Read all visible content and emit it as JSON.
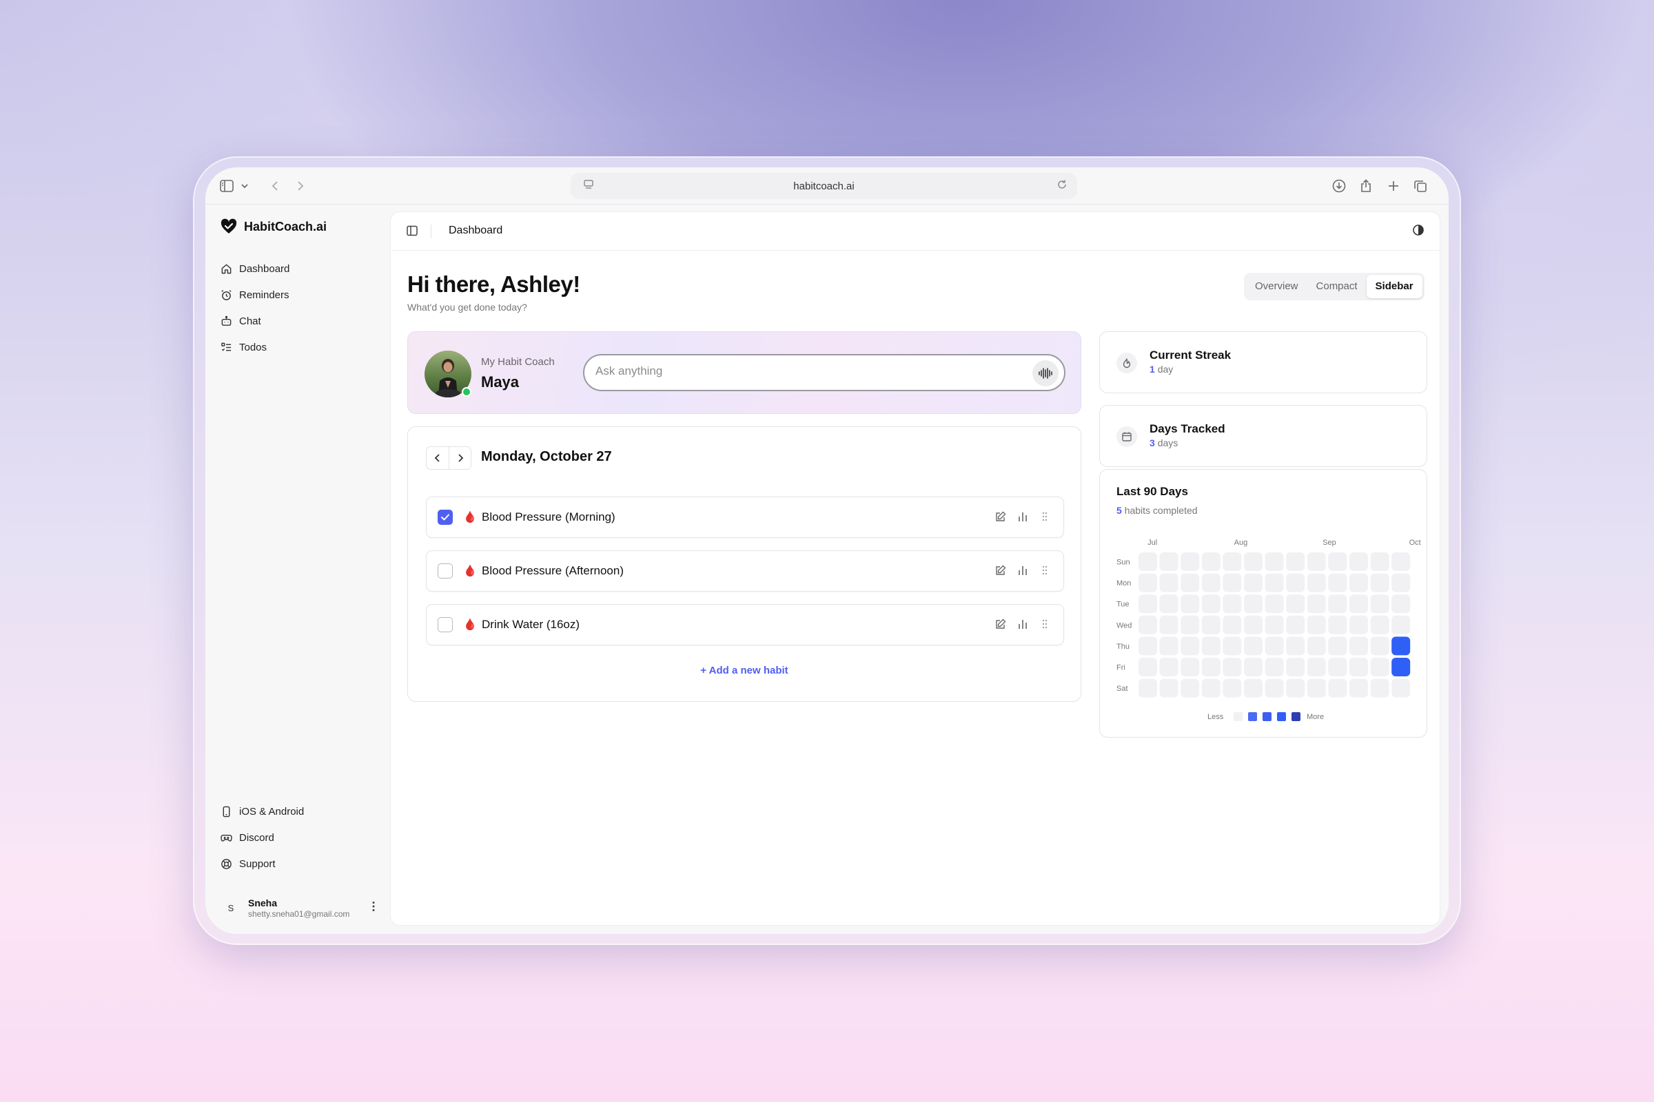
{
  "browser": {
    "url": "habitcoach.ai"
  },
  "app": {
    "brand": "HabitCoach.ai"
  },
  "sidebar": {
    "nav": [
      {
        "label": "Dashboard",
        "icon": "home-icon"
      },
      {
        "label": "Reminders",
        "icon": "alarm-clock-icon"
      },
      {
        "label": "Chat",
        "icon": "bot-icon"
      },
      {
        "label": "Todos",
        "icon": "list-todo-icon"
      }
    ],
    "bottom": [
      {
        "label": "iOS & Android",
        "icon": "smartphone-icon"
      },
      {
        "label": "Discord",
        "icon": "gamepad-icon"
      },
      {
        "label": "Support",
        "icon": "life-buoy-icon"
      }
    ],
    "user": {
      "initial": "S",
      "name": "Sneha",
      "email": "shetty.sneha01@gmail.com"
    }
  },
  "header": {
    "title": "Dashboard"
  },
  "greeting": {
    "title": "Hi there, Ashley!",
    "subtitle": "What'd you get done today?"
  },
  "view_toggle": {
    "options": [
      "Overview",
      "Compact",
      "Sidebar"
    ],
    "selected": "Sidebar"
  },
  "coach": {
    "label": "My Habit Coach",
    "name": "Maya",
    "status": "online",
    "ask_placeholder": "Ask anything",
    "ask_value": ""
  },
  "habits": {
    "date": "Monday, October 27",
    "items": [
      {
        "name": "Blood Pressure (Morning)",
        "emoji": "🩸",
        "checked": true
      },
      {
        "name": "Blood Pressure (Afternoon)",
        "emoji": "🩸",
        "checked": false
      },
      {
        "name": "Drink Water (16oz)",
        "emoji": "🩸",
        "checked": false
      }
    ],
    "add_label": "+ Add a new habit"
  },
  "stats": {
    "streak": {
      "title": "Current Streak",
      "value": "1",
      "unit": "day"
    },
    "tracked": {
      "title": "Days Tracked",
      "value": "3",
      "unit": "days"
    }
  },
  "heatmap": {
    "title": "Last 90 Days",
    "completed_count": "5",
    "completed_label": "habits completed",
    "months": [
      "Jul",
      "Aug",
      "Sep",
      "Oct"
    ],
    "days": [
      "Sun",
      "Mon",
      "Tue",
      "Wed",
      "Thu",
      "Fri",
      "Sat"
    ],
    "weeks": 13,
    "active_cells": [
      {
        "week": 12,
        "day": 4,
        "level": 3
      },
      {
        "week": 12,
        "day": 5,
        "level": 3
      }
    ],
    "legend_less": "Less",
    "legend_more": "More",
    "colors": {
      "empty": "#f1f1f3",
      "level1": "#4b6bf5",
      "level2": "#3d5ef0",
      "level3": "#2f5ff7",
      "level4": "#2f3fb0"
    }
  },
  "colors": {
    "accent": "#4f5ff0",
    "online": "#22c55e"
  }
}
